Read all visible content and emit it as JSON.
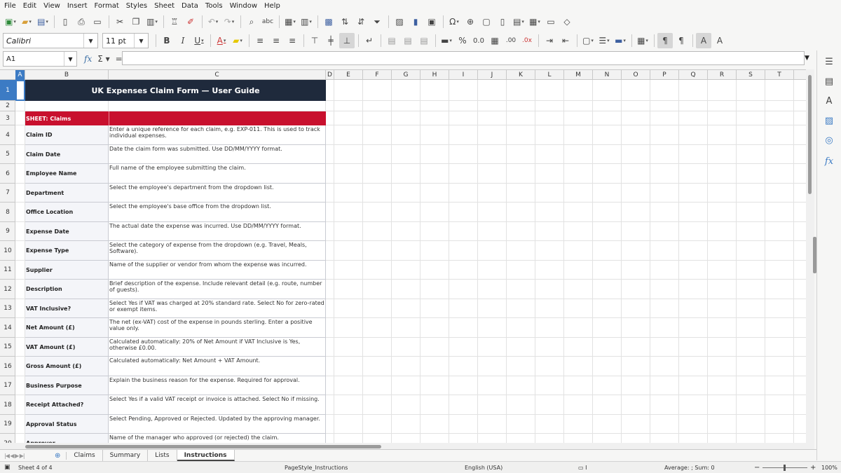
{
  "menu": [
    "File",
    "Edit",
    "View",
    "Insert",
    "Format",
    "Styles",
    "Sheet",
    "Data",
    "Tools",
    "Window",
    "Help"
  ],
  "toolbar": {
    "font_name": "Calibri",
    "font_size": "11 pt"
  },
  "formula_bar": {
    "name_box": "A1",
    "content": ""
  },
  "columns": [
    "A",
    "B",
    "C",
    "D",
    "E",
    "F",
    "G",
    "H",
    "I",
    "J",
    "K",
    "L",
    "M",
    "N",
    "O",
    "P",
    "Q",
    "R",
    "S",
    "T"
  ],
  "rows": [
    "1",
    "2",
    "3",
    "4",
    "5",
    "6",
    "7",
    "8",
    "9",
    "10",
    "11",
    "12",
    "13",
    "14",
    "15",
    "16",
    "17",
    "18",
    "19",
    "20"
  ],
  "sheet": {
    "title": "UK Expenses Claim Form — User Guide",
    "section_header": "SHEET: Claims",
    "fields": [
      {
        "name": "Claim ID",
        "desc": "Enter a unique reference for each claim, e.g. EXP-011. This is used to track individual expenses."
      },
      {
        "name": "Claim Date",
        "desc": "Date the claim form was submitted. Use DD/MM/YYYY format."
      },
      {
        "name": "Employee Name",
        "desc": "Full name of the employee submitting the claim."
      },
      {
        "name": "Department",
        "desc": "Select the employee's department from the dropdown list."
      },
      {
        "name": "Office Location",
        "desc": "Select the employee's base office from the dropdown list."
      },
      {
        "name": "Expense Date",
        "desc": "The actual date the expense was incurred. Use DD/MM/YYYY format."
      },
      {
        "name": "Expense Type",
        "desc": "Select the category of expense from the dropdown (e.g. Travel, Meals, Software)."
      },
      {
        "name": "Supplier",
        "desc": "Name of the supplier or vendor from whom the expense was incurred."
      },
      {
        "name": "Description",
        "desc": "Brief description of the expense. Include relevant detail (e.g. route, number of guests)."
      },
      {
        "name": "VAT Inclusive?",
        "desc": "Select Yes if VAT was charged at 20% standard rate. Select No for zero-rated or exempt items."
      },
      {
        "name": "Net Amount (£)",
        "desc": "The net (ex-VAT) cost of the expense in pounds sterling. Enter a positive value only."
      },
      {
        "name": "VAT Amount (£)",
        "desc": "Calculated automatically: 20% of Net Amount if VAT Inclusive is Yes, otherwise £0.00."
      },
      {
        "name": "Gross Amount (£)",
        "desc": "Calculated automatically: Net Amount + VAT Amount."
      },
      {
        "name": "Business Purpose",
        "desc": "Explain the business reason for the expense. Required for approval."
      },
      {
        "name": "Receipt Attached?",
        "desc": "Select Yes if a valid VAT receipt or invoice is attached. Select No if missing."
      },
      {
        "name": "Approval Status",
        "desc": "Select Pending, Approved or Rejected. Updated by the approving manager."
      },
      {
        "name": "Approver",
        "desc": "Name of the manager who approved (or rejected) the claim."
      }
    ]
  },
  "tabs": [
    "Claims",
    "Summary",
    "Lists",
    "Instructions"
  ],
  "status": {
    "sheet": "Sheet 4 of 4",
    "page_style": "PageStyle_Instructions",
    "language": "English (USA)",
    "summary": "Average: ; Sum: 0",
    "zoom": "100%"
  }
}
